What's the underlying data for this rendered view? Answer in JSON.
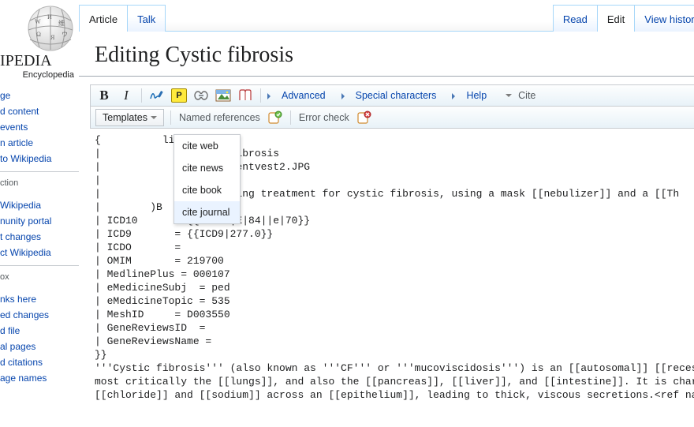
{
  "logo": {
    "wordmark": "IPEDIA",
    "tagline": "Encyclopedia"
  },
  "sidebar": {
    "main": [
      "ge",
      "d content",
      "events",
      "n article",
      "to Wikipedia"
    ],
    "interaction_heading": "ction",
    "interaction": [
      "Wikipedia",
      "nunity portal",
      "t changes",
      "ct Wikipedia"
    ],
    "tools_heading": "ox",
    "tools": [
      "nks here",
      "ed changes",
      "d file",
      "al pages",
      "d citations",
      "age names"
    ]
  },
  "tabs": {
    "article": "Article",
    "talk": "Talk",
    "read": "Read",
    "edit": "Edit",
    "history": "View history"
  },
  "heading": "Editing Cystic fibrosis",
  "toolbar": {
    "bold": "B",
    "italic": "I",
    "advanced": "Advanced",
    "special": "Special characters",
    "help": "Help",
    "cite": "Cite",
    "templates": "Templates",
    "named_refs": "Named references",
    "error_check": "Error check"
  },
  "dropdown": {
    "items": [
      "cite web",
      "cite news",
      "cite book",
      "cite journal"
    ]
  },
  "editor": {
    "text": "{          lisease\n|            = Cystic fibrosis\n|            = CFtreatmentvest2.JPG\n|            =\n|            = A breathing treatment for cystic fibrosis, using a mask [[nebulizer]] and a [[Th\n|        )B  = 3347\n| ICD10      = {{ICD10|E|84||e|70}}\n| ICD9       = {{ICD9|277.0}}\n| ICDO       =\n| OMIM       = 219700\n| MedlinePlus = 000107\n| eMedicineSubj  = ped\n| eMedicineTopic = 535\n| MeshID     = D003550\n| GeneReviewsID  =\n| GeneReviewsName =\n}}\n'''Cystic fibrosis''' (also known as '''CF''' or '''mucoviscidosis''') is an [[autosomal]] [[recessi\nmost critically the [[lungs]], and also the [[pancreas]], [[liver]], and [[intestine]]. It is charac\n[[chloride]] and [[sodium]] across an [[epithelium]], leading to thick, viscous secretions.<ref name"
  }
}
